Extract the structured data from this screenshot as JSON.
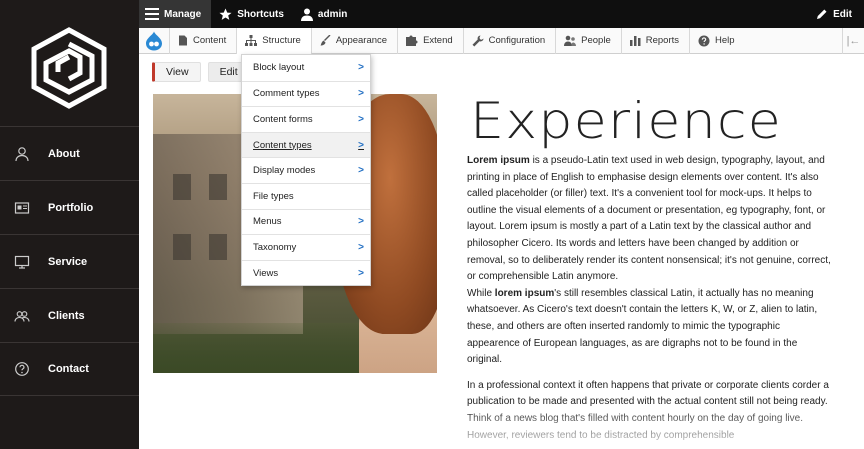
{
  "topbar": {
    "manage": "Manage",
    "shortcuts": "Shortcuts",
    "user": "admin",
    "edit": "Edit"
  },
  "tray": {
    "items": [
      "Content",
      "Structure",
      "Appearance",
      "Extend",
      "Configuration",
      "People",
      "Reports",
      "Help"
    ]
  },
  "tabs": [
    "View",
    "Edit"
  ],
  "structure_menu": [
    "Block layout",
    "Comment types",
    "Content forms",
    "Content types",
    "Display modes",
    "File types",
    "Menus",
    "Taxonomy",
    "Views"
  ],
  "sidebar": {
    "items": [
      {
        "label": "About",
        "icon": "user-icon"
      },
      {
        "label": "Portfolio",
        "icon": "id-card-icon"
      },
      {
        "label": "Service",
        "icon": "monitor-icon"
      },
      {
        "label": "Clients",
        "icon": "users-icon"
      },
      {
        "label": "Contact",
        "icon": "question-circle-icon"
      }
    ]
  },
  "article": {
    "title": "Experience",
    "p1_bold": "Lorem ipsum",
    "p1_text": " is a pseudo-Latin text used in web design, typography, layout, and printing in place of English to emphasise design elements over content. It's also called placeholder (or filler) text. It's a convenient tool for mock-ups. It helps to outline the visual elements of a document or presentation, eg typography, font, or layout. Lorem ipsum is mostly a part of a Latin text by the classical author and philosopher Cicero. Its words and letters have been changed by addition or removal, so to deliberately render its content nonsensical; it's not genuine, correct, or comprehensible Latin anymore.",
    "p2_pre": "While ",
    "p2_bold": "lorem ipsum",
    "p2_text": "'s still resembles classical Latin, it actually has no meaning whatsoever. As Cicero's text doesn't contain the letters K, W, or Z, alien to latin, these, and others are often inserted randomly to mimic the typographic appearence of European languages, as are digraphs not to be found in the original.",
    "p3_text": "In a professional context it often happens that private or corporate clients corder a publication to be made and presented with the actual content still not being ready. Think of a news blog that's filled with content hourly on the day of going live. However, reviewers tend to be distracted by comprehensible"
  },
  "colors": {
    "sidebar_bg": "#1e1a19",
    "topbar_bg": "#0f0f0f",
    "link_accent": "#1f6dc2",
    "active_tab_accent": "#c0392b"
  }
}
